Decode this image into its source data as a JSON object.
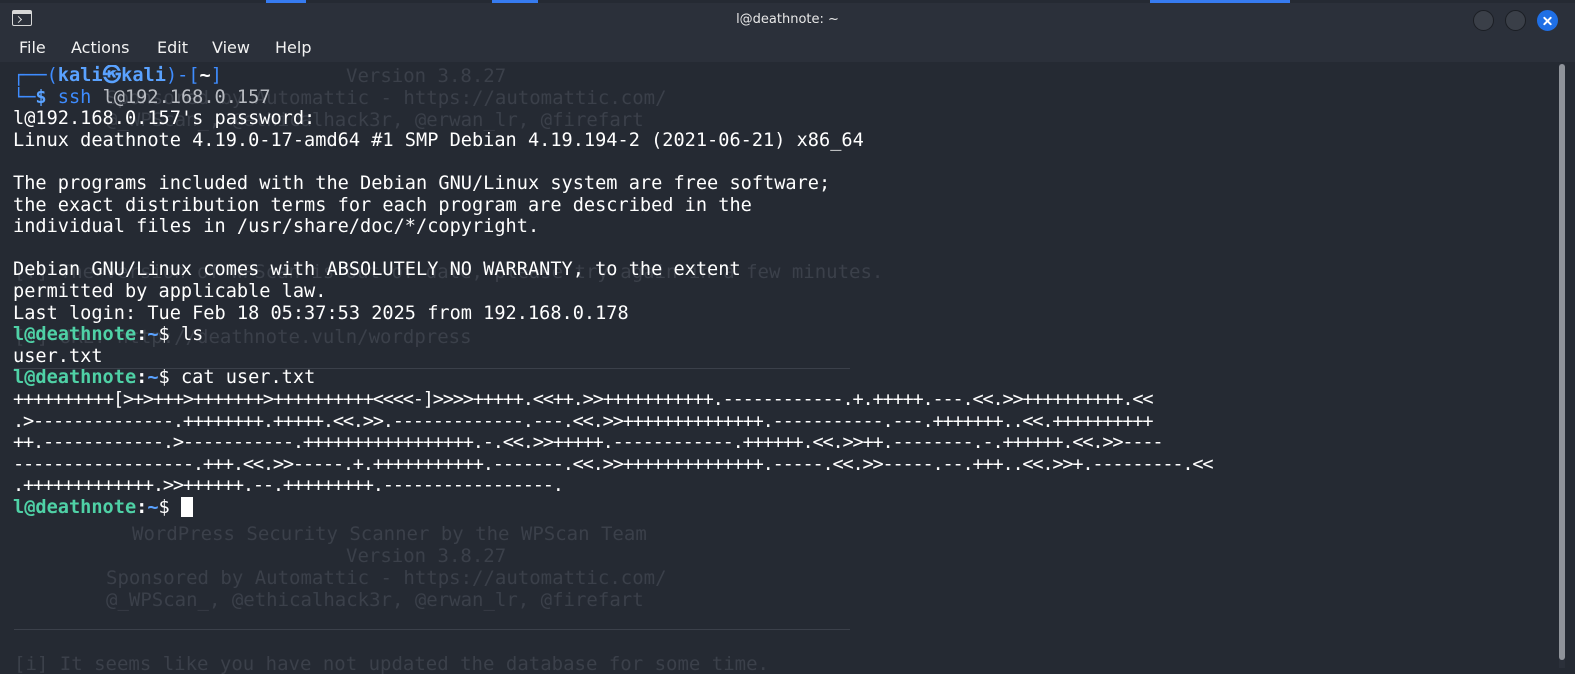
{
  "window": {
    "title": "l@deathnote: ~"
  },
  "menu": {
    "file": "File",
    "actions": "Actions",
    "edit": "Edit",
    "view": "View",
    "help": "Help"
  },
  "terminal": {
    "prompt1": {
      "corner_top": "┌──(",
      "user": "kali",
      "at_symbol": "㉿",
      "host": "kali",
      "bracket_open": ")-[",
      "dir": "~",
      "bracket_close": "]",
      "corner_bottom": "└─",
      "dollar": "$",
      "cmd_name": "ssh",
      "cmd_arg": "l@192.168.0.157"
    },
    "output": [
      "l@192.168.0.157's password:",
      "Linux deathnote 4.19.0-17-amd64 #1 SMP Debian 4.19.194-2 (2021-06-21) x86_64",
      "",
      "The programs included with the Debian GNU/Linux system are free software;",
      "the exact distribution terms for each program are described in the",
      "individual files in /usr/share/doc/*/copyright.",
      "",
      "Debian GNU/Linux comes with ABSOLUTELY NO WARRANTY, to the extent",
      "permitted by applicable law.",
      "Last login: Tue Feb 18 05:37:53 2025 from 192.168.0.178"
    ],
    "prompt_user_host": "l@deathnote",
    "prompt_colon": ":",
    "prompt_tilde": "~",
    "prompt_dollar": "$ ",
    "cmd_ls": "ls",
    "ls_output": "user.txt",
    "cmd_cat": "cat user.txt",
    "brainfuck_lines": [
      "++++++++++[>+>+++>+++++++>++++++++++<<<<-]>>>>+++++.<<++.>>+++++++++++.------------.+.+++++.---.<<.>>++++++++++.<<",
      ".>--------------.++++++++.+++++.<<.>>.-------------.---.<<.>>++++++++++++++.-----------.---.+++++++..<<.++++++++++",
      "++.------------.>-----------.+++++++++++++++++.-.<<.>>+++++.------------.++++++.<<.>>++.--------.-.++++++.<<.>>----",
      "------------------.+++.<<.>>-----.+.+++++++++++.-------.<<.>>++++++++++++++.-----.<<.>>-----.--.+++..<<.>>+.---------.<<",
      ".+++++++++++++.>>++++++.--.+++++++++.-----------------."
    ]
  },
  "ghost_text": {
    "version_top": "Version 3.8.27",
    "sponsor_top": "Sponsored by Automattic - https://automattic.com/",
    "credits_top": "@_WPScan_, @ethicalhack3r, @erwan_lr, @firefart",
    "again_line": "[!] The version of WPScan is out of date, please try again in a few minutes.",
    "url_line": "[+] URL: http://deathnote.vuln/wordpress",
    "scanner": "WordPress Security Scanner by the WPScan Team",
    "version_bottom": "Version 3.8.27",
    "sponsor_bottom": "Sponsored by Automattic - https://automattic.com/",
    "credits_bottom": "@_WPScan_, @ethicalhack3r, @erwan_lr, @firefart",
    "update_line": "[i] It seems like you have not updated the database for some time."
  },
  "colors": {
    "background": "#252a33",
    "prompt_blue": "#3e8cff",
    "prompt_green": "#4fd1a6",
    "close_button": "#1f6fe5"
  },
  "icons": {
    "terminal": "terminal-icon",
    "minimize": "minimize-icon",
    "maximize": "maximize-icon",
    "close": "close-icon"
  }
}
